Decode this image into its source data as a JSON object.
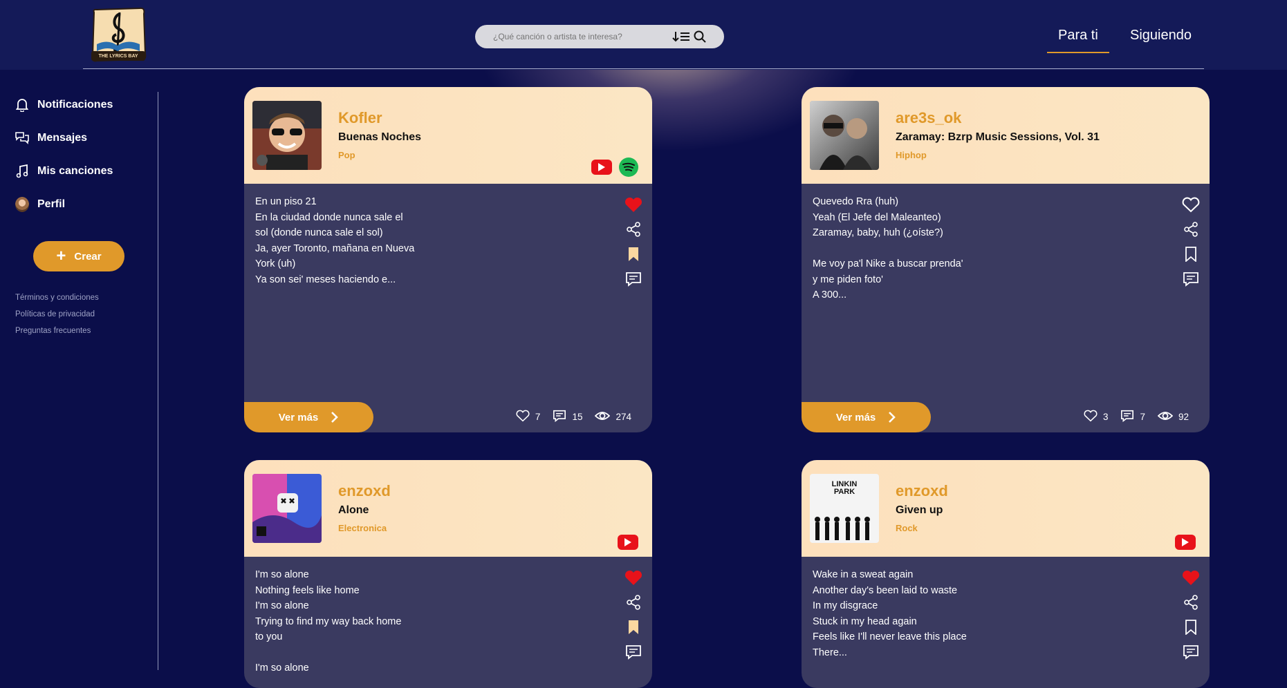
{
  "header": {
    "logo_text": "THE LYRICS BAY",
    "search": {
      "placeholder": "¿Qué canción o artista te interesa?"
    },
    "tabs": [
      {
        "label": "Para ti",
        "active": true
      },
      {
        "label": "Siguiendo",
        "active": false
      }
    ]
  },
  "sidebar": {
    "items": [
      {
        "label": "Notificaciones",
        "icon": "bell-icon"
      },
      {
        "label": "Mensajes",
        "icon": "chat-icon"
      },
      {
        "label": "Mis canciones",
        "icon": "music-note-icon"
      },
      {
        "label": "Perfil",
        "icon": "avatar"
      }
    ],
    "create_label": "Crear",
    "footer_links": [
      "Términos y condiciones",
      "Políticas de privacidad",
      "Preguntas frecuentes"
    ]
  },
  "colors": {
    "accent": "#e0992a",
    "background": "#0b0e4a",
    "card_body": "#3a3a60",
    "card_head": "#fde0bc",
    "like": "#e8121a"
  },
  "posts": [
    {
      "user": "Kofler",
      "song": "Buenas Noches",
      "genre": "Pop",
      "platforms": [
        "youtube",
        "spotify"
      ],
      "liked": true,
      "bookmarked": true,
      "lyrics": "En un piso 21\nEn la ciudad donde nunca sale el\nsol (donde nunca sale el sol)\nJa, ayer Toronto, mañana en Nueva\nYork (uh)\nYa son sei' meses haciendo e...",
      "more_label": "Ver más",
      "likes": "7",
      "comments": "15",
      "views": "274"
    },
    {
      "user": "are3s_ok",
      "song": "Zaramay: Bzrp Music Sessions, Vol. 31",
      "genre": "Hiphop",
      "platforms": [],
      "liked": false,
      "bookmarked": false,
      "lyrics": "Quevedo Rra (huh)\nYeah (El Jefe del Maleanteo)\nZaramay, baby, huh (¿oíste?)\n\nMe voy pa'l Nike a buscar prenda'\ny me piden foto'\nA 300...",
      "more_label": "Ver más",
      "likes": "3",
      "comments": "7",
      "views": "92"
    },
    {
      "user": "enzoxd",
      "song": "Alone",
      "genre": "Electronica",
      "platforms": [
        "youtube"
      ],
      "liked": true,
      "bookmarked": true,
      "lyrics": "I'm so alone\nNothing feels like home\nI'm so alone\nTrying to find my way back home\nto you\n\nI'm so alone"
    },
    {
      "user": "enzoxd",
      "song": "Given up",
      "genre": "Rock",
      "platforms": [
        "youtube"
      ],
      "liked": true,
      "bookmarked": false,
      "album_text": "LINKIN PARK",
      "lyrics": "Wake in a sweat again\nAnother day's been laid to waste\nIn my disgrace\nStuck in my head again\nFeels like I'll never leave this place\nThere..."
    }
  ]
}
